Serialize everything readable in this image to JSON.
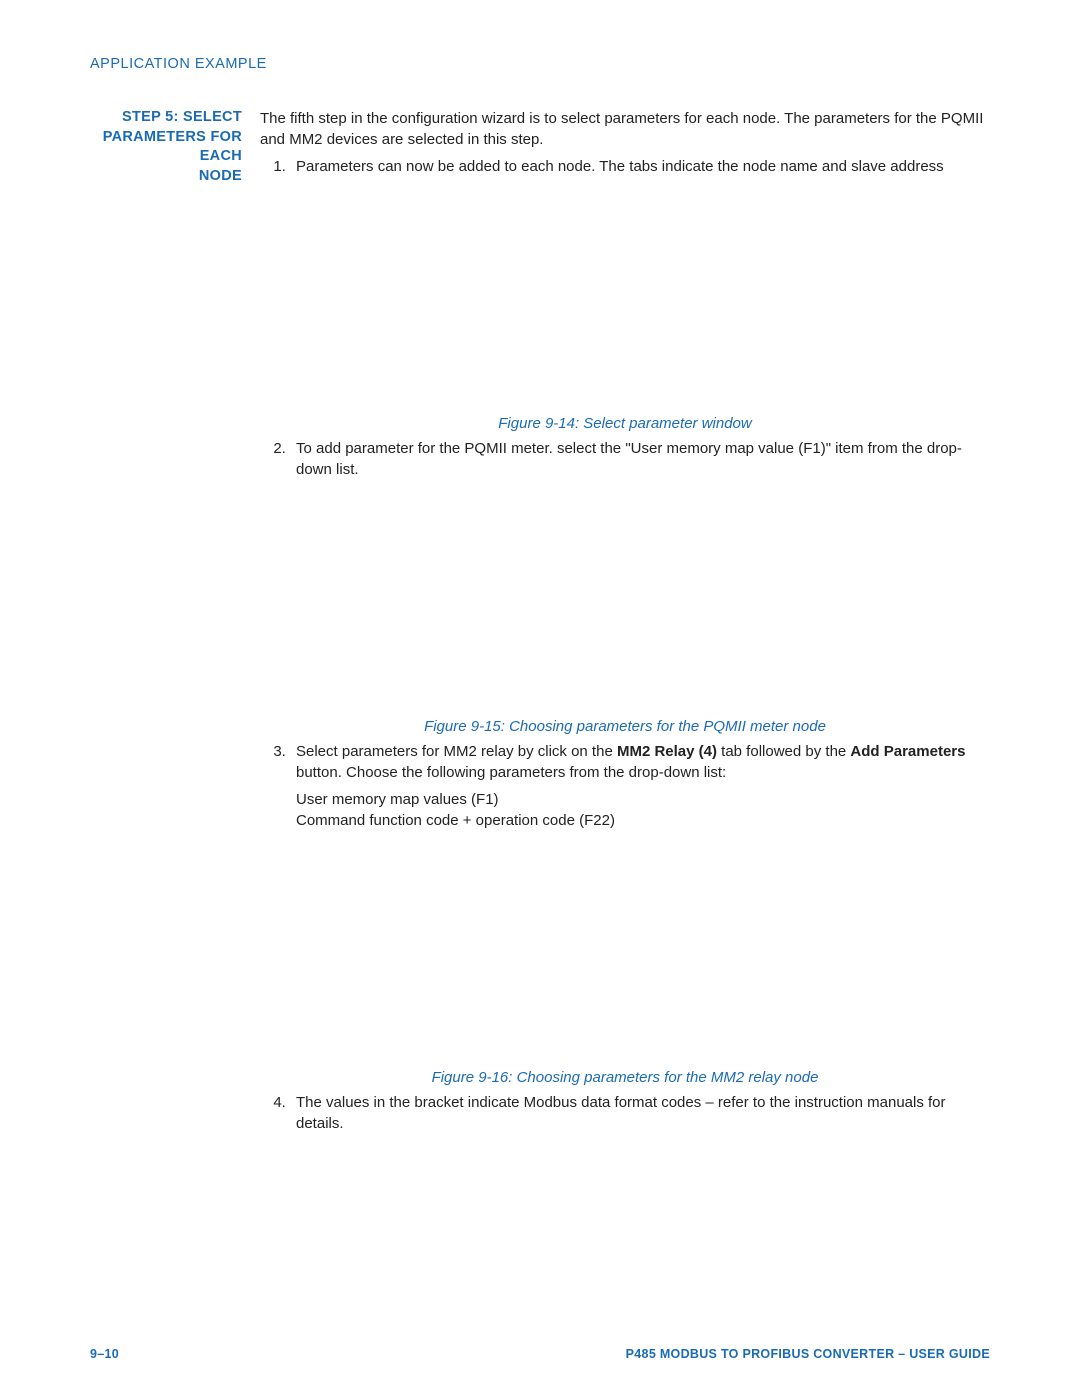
{
  "header": {
    "section_title": "APPLICATION EXAMPLE"
  },
  "side_heading": {
    "line1": "STEP 5: SELECT",
    "line2": "PARAMETERS FOR EACH",
    "line3": "NODE"
  },
  "intro": "The fifth step in the configuration wizard is to select parameters for each node. The parameters for the PQMII and MM2 devices are selected in this step.",
  "steps": {
    "s1": "Parameters can now be added to each node. The tabs indicate the node name and slave address",
    "s2": "To add parameter for the PQMII meter. select the \"User memory map value (F1)\" item from the drop-down list.",
    "s3_pre": "Select parameters for MM2 relay by click on the ",
    "s3_bold1": "MM2 Relay (4)",
    "s3_mid": " tab followed by the ",
    "s3_bold2": "Add Parameters",
    "s3_post": " button. Choose the following parameters from the drop-down list:",
    "s3_lineA": "User memory map values (F1)",
    "s3_lineB": "Command function code + operation code (F22)",
    "s4": "The values in the bracket indicate Modbus data format codes – refer to the instruction manuals for details."
  },
  "figures": {
    "f14": "Figure 9-14: Select parameter window",
    "f15": "Figure 9-15: Choosing parameters for the PQMII meter node",
    "f16": "Figure 9-16: Choosing parameters for the MM2 relay node"
  },
  "footer": {
    "page_num": "9–10",
    "doc_title": "P485 MODBUS TO PROFIBUS CONVERTER – USER GUIDE"
  }
}
